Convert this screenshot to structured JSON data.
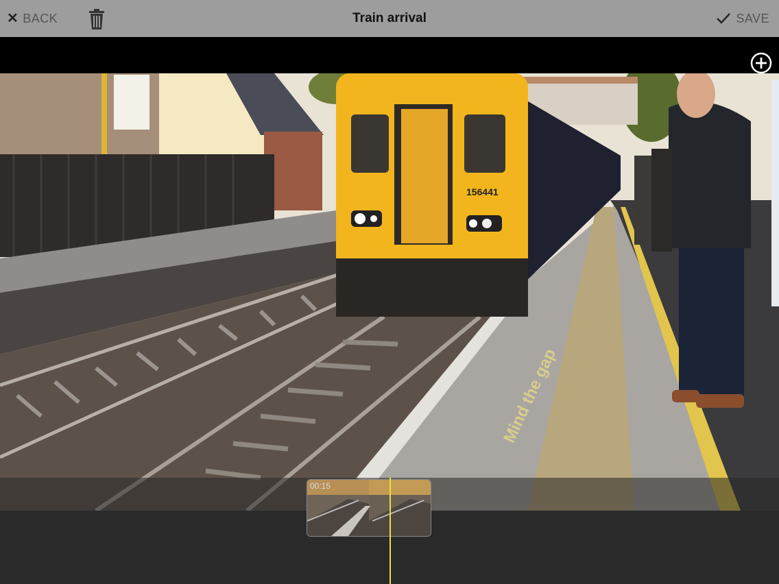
{
  "toolbar": {
    "back_label": "BACK",
    "title": "Train arrival",
    "save_label": "SAVE"
  },
  "icons": {
    "back": "close-icon",
    "delete": "trash-icon",
    "save": "checkmark-icon",
    "add": "plus-circle-icon"
  },
  "video": {
    "train_number": "156441",
    "platform_text": "Mind the gap"
  },
  "timeline": {
    "clip_time": "00:15"
  },
  "colors": {
    "toolbar_bg": "#9d9d9d",
    "playhead": "#e8e23a",
    "train_yellow": "#f2b51d"
  }
}
